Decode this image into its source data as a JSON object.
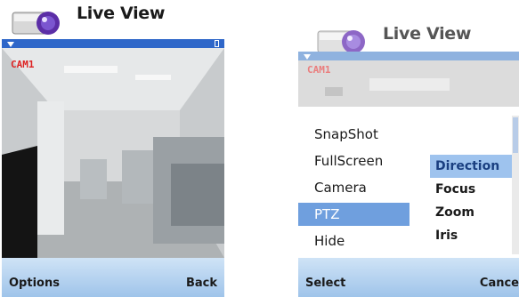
{
  "screen_left": {
    "title": "Live View",
    "camera_label": "CAM1",
    "softkey_left": "Options",
    "softkey_right": "Back"
  },
  "screen_right": {
    "title": "Live View",
    "camera_label": "CAM1",
    "menu_items": [
      "SnapShot",
      "FullScreen",
      "Camera",
      "PTZ",
      "Hide"
    ],
    "selected_menu_item": "PTZ",
    "submenu_items": [
      "Direction",
      "Focus",
      "Zoom",
      "Iris"
    ],
    "selected_submenu_item": "Direction",
    "softkey_left": "Select",
    "softkey_right": "Cance"
  },
  "colors": {
    "status_bar": "#2f67c9",
    "menu_selected": "#6f9fde",
    "submenu_selected": "#9ec3ee",
    "softkey_bar": "#9fc4ea",
    "camera_label": "#d22"
  },
  "icons": {
    "app_icon": "camera-icon",
    "signal": "signal-icon",
    "battery": "battery-icon"
  }
}
